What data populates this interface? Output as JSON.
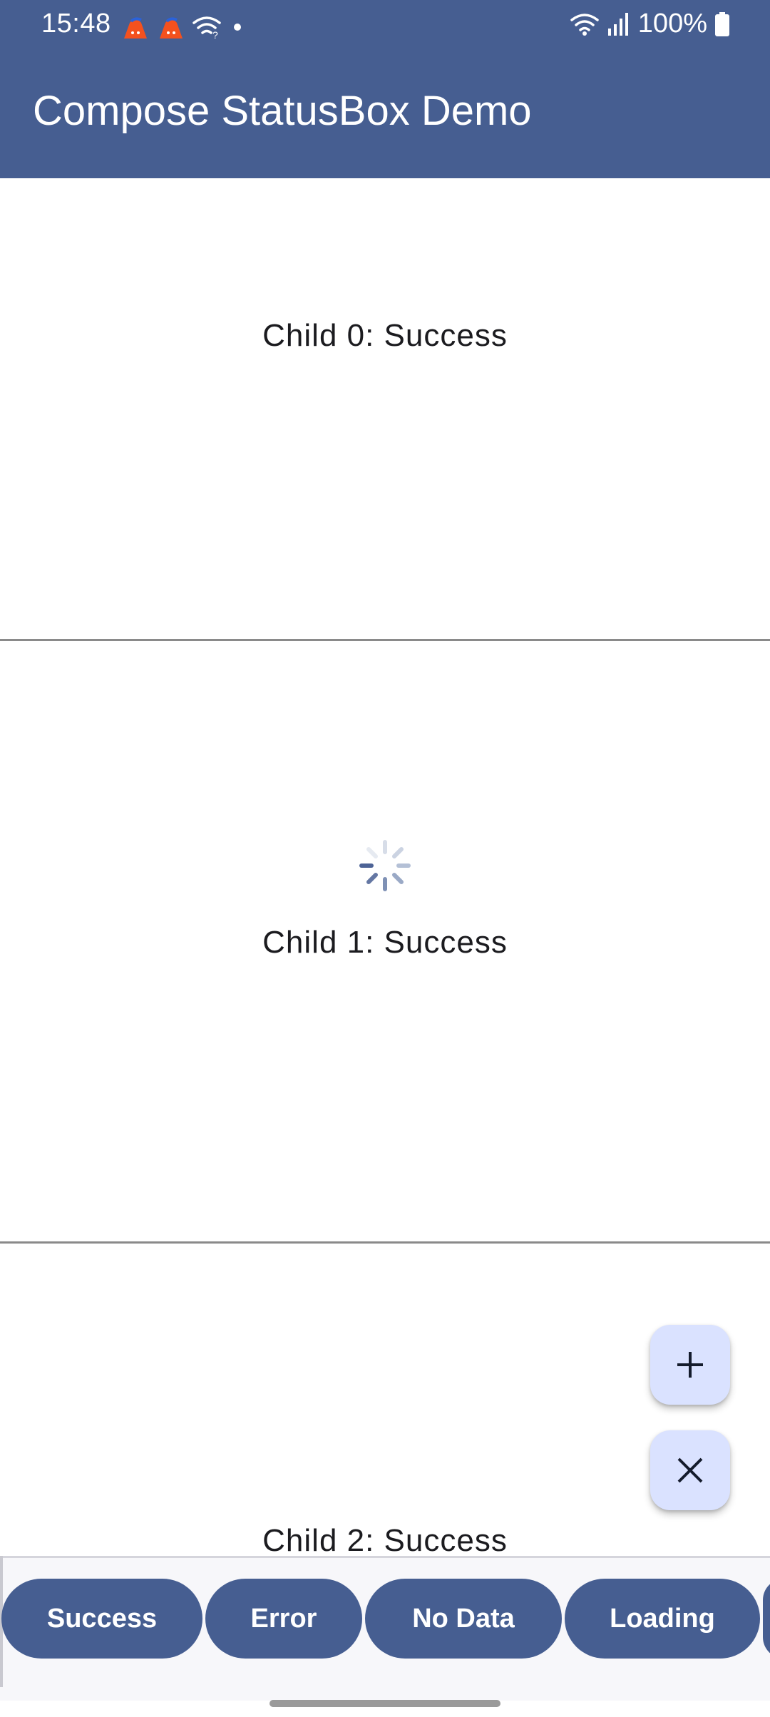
{
  "status_bar": {
    "time": "15:48",
    "battery": "100%",
    "left_icons": [
      "app-notification-icon",
      "app-notification-icon",
      "wifi-question-icon",
      "dot-icon"
    ],
    "right_icons": [
      "wifi-icon",
      "signal-icon",
      "battery-icon"
    ]
  },
  "app_bar": {
    "title": "Compose StatusBox Demo",
    "background": "#465e91"
  },
  "children": [
    {
      "label": "Child 0: Success"
    },
    {
      "label": "Child 1: Success",
      "loading": true
    },
    {
      "label": "Child 2: Success"
    }
  ],
  "fabs": {
    "add_icon": "plus-icon",
    "close_icon": "close-icon",
    "background": "#dae2ff"
  },
  "status_buttons": [
    {
      "label": "Success"
    },
    {
      "label": "Error"
    },
    {
      "label": "No Data"
    },
    {
      "label": "Loading"
    }
  ],
  "colors": {
    "accent": "#465e91",
    "fab": "#dae2ff",
    "divider": "#8a8a8a"
  }
}
